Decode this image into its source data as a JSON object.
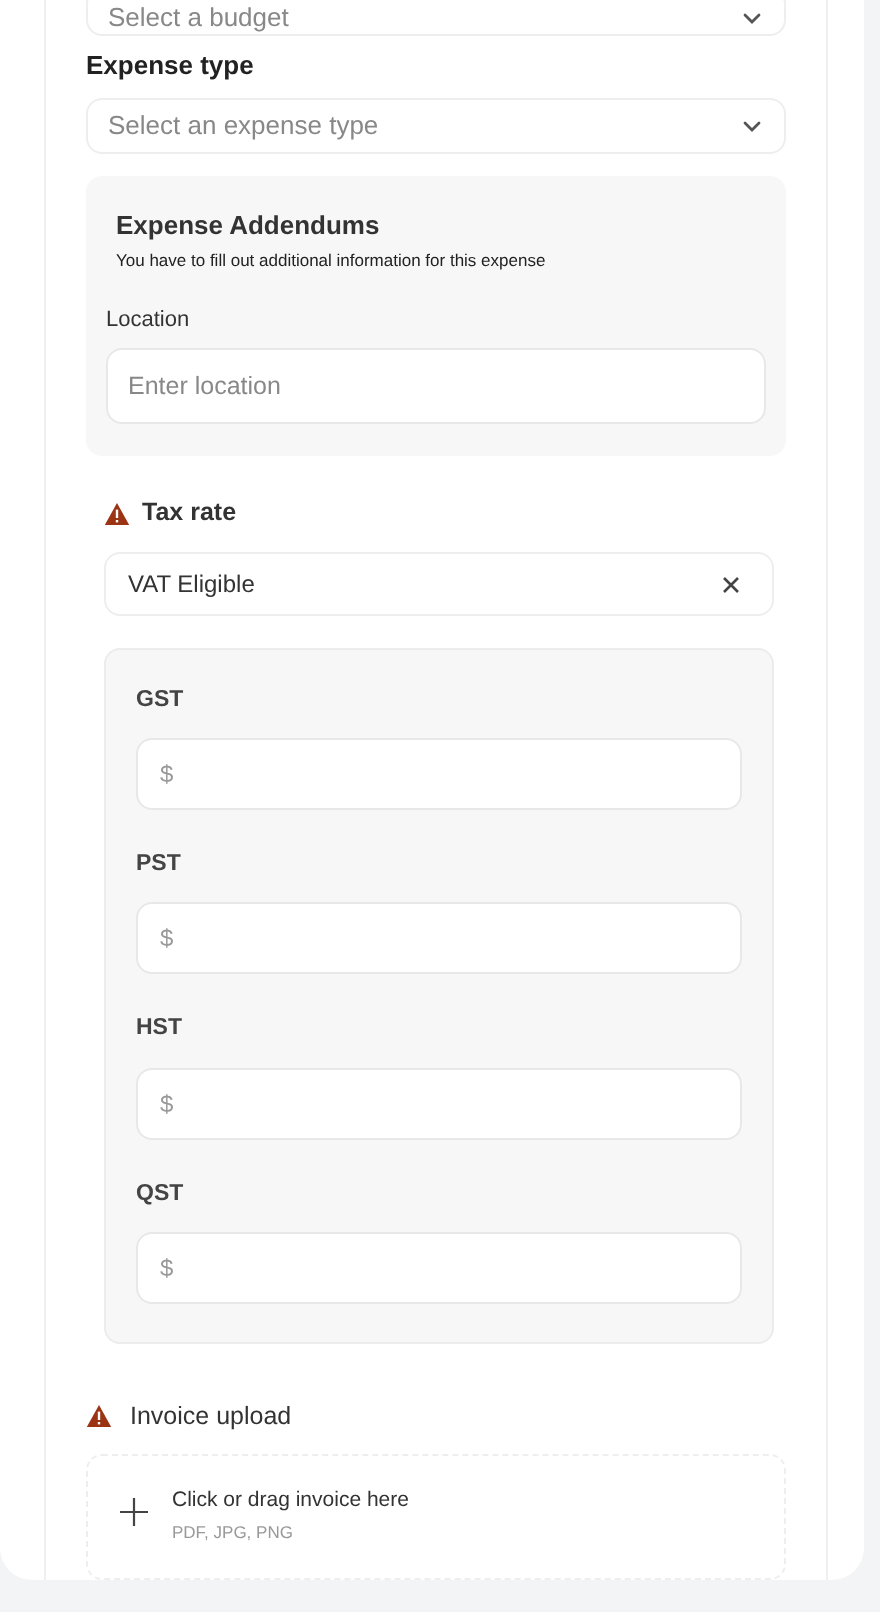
{
  "budget": {
    "placeholder": "Select a budget"
  },
  "expense_type": {
    "label": "Expense type",
    "placeholder": "Select an expense type"
  },
  "addendums": {
    "title": "Expense Addendums",
    "subtitle": "You have to fill out additional information for this expense",
    "fields": [
      {
        "label": "Location",
        "placeholder": "Enter location"
      }
    ]
  },
  "tax_rate": {
    "label": "Tax rate",
    "warning": true,
    "value": "VAT Eligible",
    "taxes": [
      {
        "label": "GST",
        "placeholder": "$"
      },
      {
        "label": "PST",
        "placeholder": "$"
      },
      {
        "label": "HST",
        "placeholder": "$"
      },
      {
        "label": "QST",
        "placeholder": "$"
      }
    ]
  },
  "invoice": {
    "label": "Invoice upload",
    "warning": true,
    "prompt": "Click or drag invoice here",
    "formats": "PDF, JPG, PNG"
  }
}
